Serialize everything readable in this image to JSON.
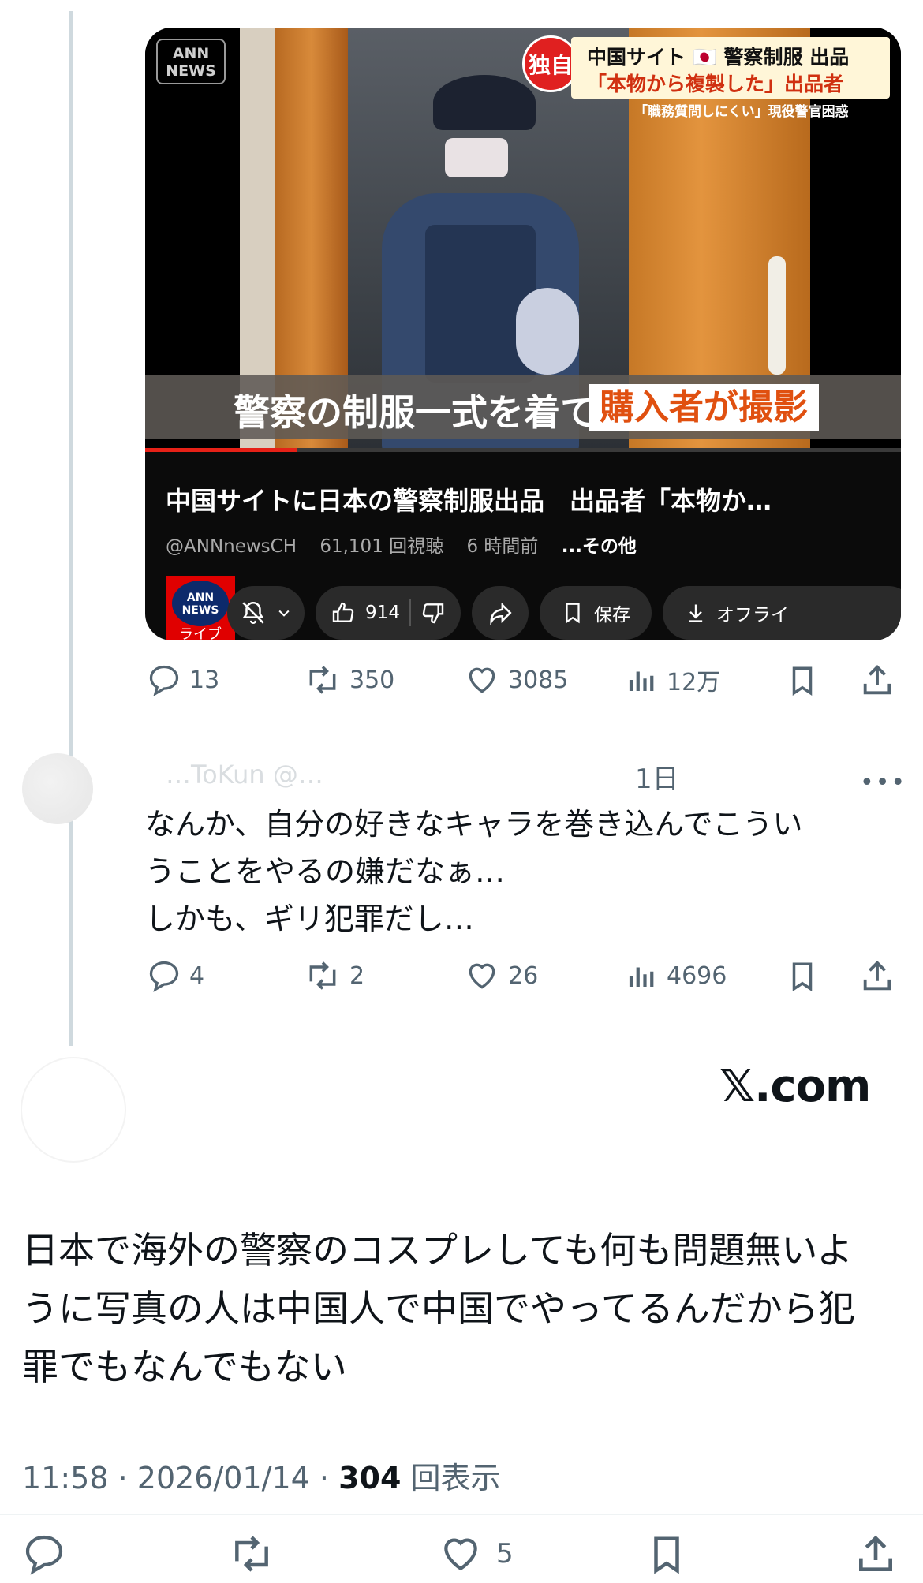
{
  "video": {
    "channel_logo": "ANN\nNEWS",
    "badge": "独自",
    "headline_line1": "中国サイト 🇯🇵 警察制服 出品",
    "headline_line2": "「本物から複製した」出品者",
    "headline_sub": "「職務質問しにくい」現役警官困惑",
    "caption_main": "警察の制服一式を着て",
    "caption_highlight": "購入者が撮影",
    "progress_percent": 20,
    "title": "中国サイトに日本の警察制服出品　出品者「本物か…",
    "handle": "@ANNnewsCH",
    "views": "61,101 回視聴",
    "age": "6 時間前",
    "more": "...その他",
    "avatar_label": "ANN\nNEWS",
    "avatar_live": "ライブ",
    "like_count": "914",
    "save_label": "保存",
    "offline_label": "オフライ"
  },
  "quoted_tweet_actions": {
    "replies": "13",
    "reposts": "350",
    "likes": "3085",
    "views": "12万"
  },
  "reply": {
    "author_blurred": "…ToKun @…",
    "time": "1日",
    "text_lines": [
      "なんか、自分の好きなキャラを巻き込んでこうい",
      "うことをやるの嫌だなぁ…",
      "しかも、ギリ犯罪だし…"
    ],
    "replies": "4",
    "reposts": "2",
    "likes": "26",
    "views": "4696"
  },
  "watermark": "𝕏.com",
  "main_tweet": {
    "text_lines": [
      "日本で海外の警察のコスプレしても何も問題無いよ",
      "うに写真の人は中国人で中国でやってるんだから犯",
      "罪でもなんでもない"
    ],
    "time": "11:58",
    "date": "2026/01/14",
    "view_count": "304",
    "view_label": "回表示",
    "likes": "5"
  },
  "colors": {
    "text": "#0f1419",
    "secondary": "#536471",
    "thread_line": "#cfd9de",
    "progress": "#e62117"
  }
}
